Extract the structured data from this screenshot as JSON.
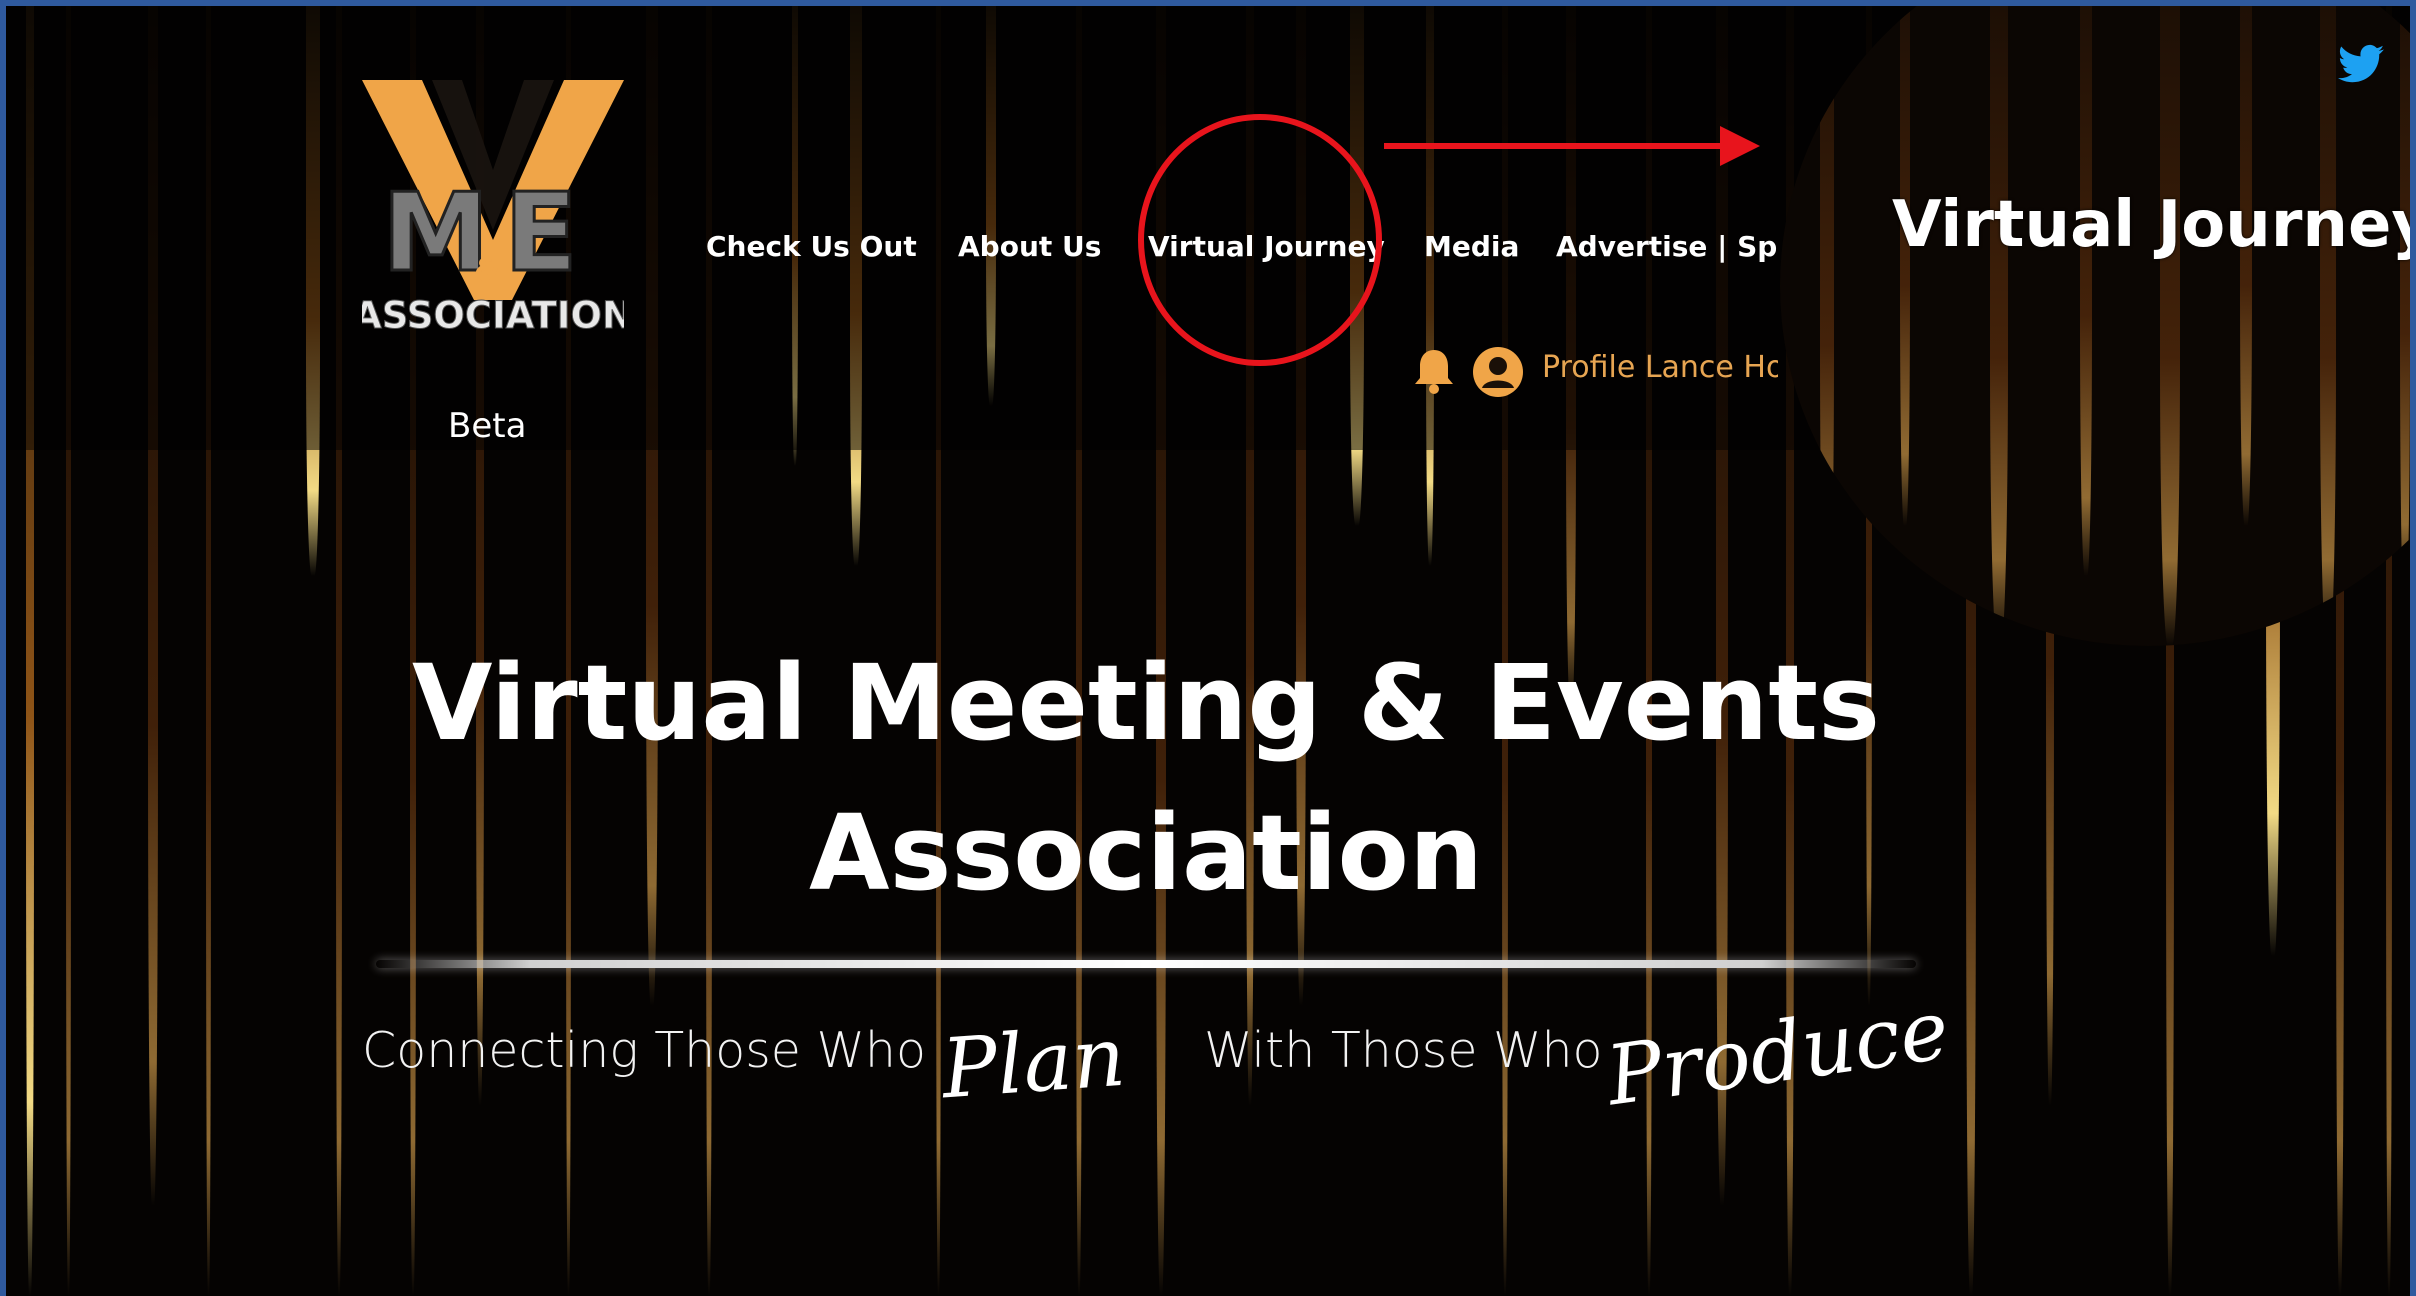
{
  "site": {
    "logo": {
      "text_top": "V",
      "monogram": "M&E",
      "text_bottom": "ASSOCIATION"
    },
    "nav": [
      {
        "label": "Check Us Out"
      },
      {
        "label": "About Us"
      },
      {
        "label": "Virtual Journey"
      },
      {
        "label": "Media"
      },
      {
        "label": "Advertise | Spo"
      }
    ],
    "user": {
      "profile_label": "Profile Lance Ho",
      "notification_icon": "bell-icon",
      "avatar_icon": "user-avatar-icon"
    },
    "beta_label": "Beta",
    "social": {
      "icon": "twitter-icon",
      "color": "#1da1f2"
    }
  },
  "hero": {
    "title_line_1": "Virtual Meeting & Events",
    "title_line_2": "Association",
    "tagline_1": "Connecting Those Who",
    "tagline_script_1": "Plan",
    "tagline_2": "With Those Who",
    "tagline_script_2": "Produce"
  },
  "annotation": {
    "zoom_label": "Virtual Journey",
    "highlight_color": "#e8141c"
  },
  "colors": {
    "accent_orange": "#f0a548",
    "profile_text": "#e7a552",
    "outer_border": "#2f5a9e"
  }
}
